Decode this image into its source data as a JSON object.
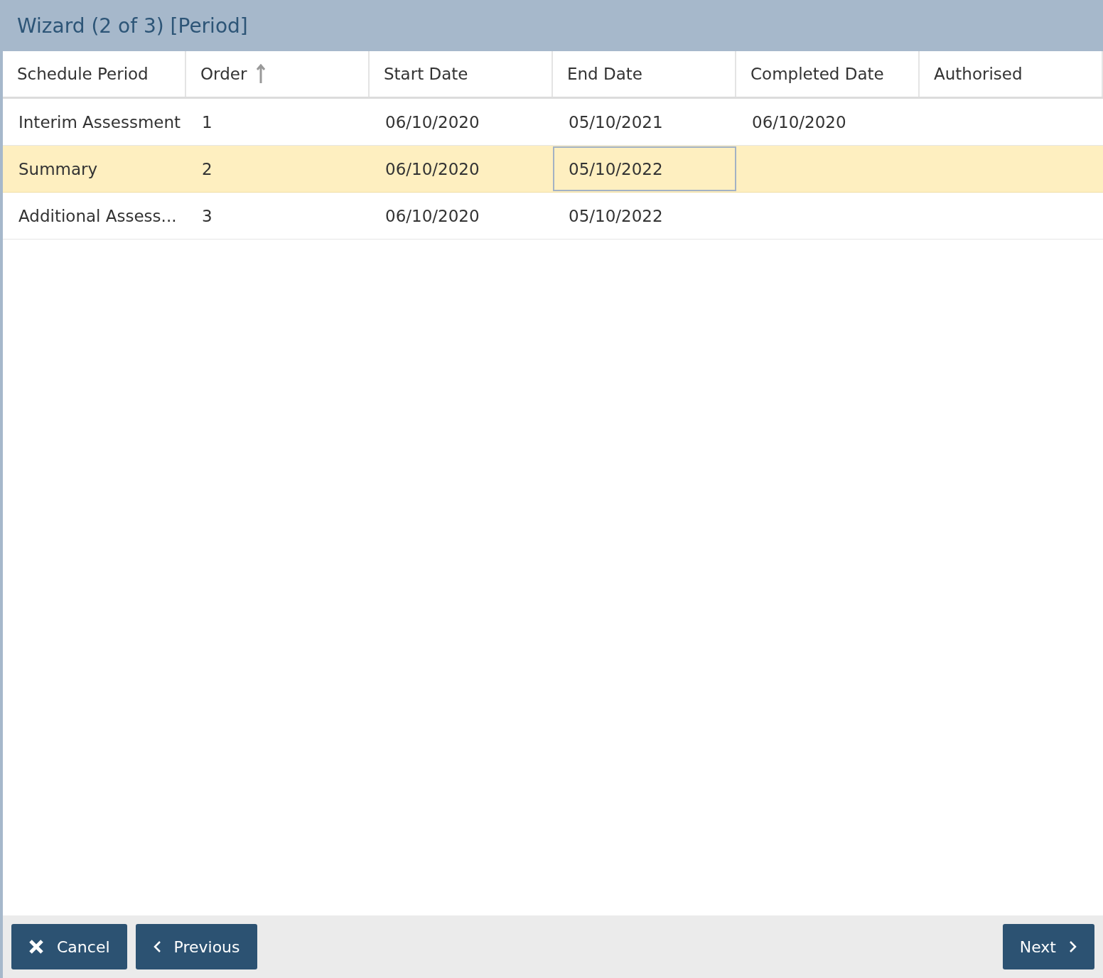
{
  "window": {
    "title": "Wizard (2 of 3) [Period]"
  },
  "table": {
    "columns": [
      {
        "label": "Schedule Period",
        "sorted": false
      },
      {
        "label": "Order",
        "sorted": true
      },
      {
        "label": "Start Date",
        "sorted": false
      },
      {
        "label": "End Date",
        "sorted": false
      },
      {
        "label": "Completed Date",
        "sorted": false
      },
      {
        "label": "Authorised",
        "sorted": false
      }
    ],
    "rows": [
      {
        "selected": false,
        "cells": [
          {
            "text": "Interim Assessment",
            "focused": false
          },
          {
            "text": "1",
            "focused": false
          },
          {
            "text": "06/10/2020",
            "focused": false
          },
          {
            "text": "05/10/2021",
            "focused": false
          },
          {
            "text": "06/10/2020",
            "focused": false
          }
        ]
      },
      {
        "selected": true,
        "cells": [
          {
            "text": "Summary",
            "focused": false
          },
          {
            "text": "2",
            "focused": false
          },
          {
            "text": "06/10/2020",
            "focused": false
          },
          {
            "text": "05/10/2022",
            "focused": true
          }
        ]
      },
      {
        "selected": false,
        "cells": [
          {
            "text": "Additional Assess...",
            "focused": false
          },
          {
            "text": "3",
            "focused": false
          },
          {
            "text": "06/10/2020",
            "focused": false
          },
          {
            "text": "05/10/2022",
            "focused": false
          }
        ]
      }
    ]
  },
  "footer": {
    "buttons": [
      {
        "kind": "cancel",
        "label": "Cancel"
      },
      {
        "kind": "previous",
        "label": "Previous"
      },
      {
        "kind": "next",
        "label": "Next"
      }
    ]
  }
}
